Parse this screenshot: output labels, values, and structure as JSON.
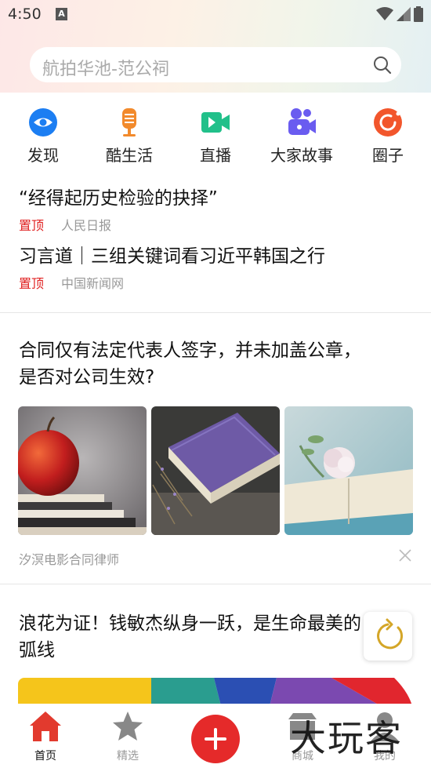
{
  "status_bar": {
    "time": "4:50",
    "a_badge": "A"
  },
  "search": {
    "placeholder": "航拍华池-范公祠"
  },
  "quick_nav": [
    {
      "label": "发现",
      "icon": "eye-icon",
      "color": "#1c7ef2"
    },
    {
      "label": "酷生活",
      "icon": "microphone-icon",
      "color": "#f28a2c"
    },
    {
      "label": "直播",
      "icon": "video-camera-icon",
      "color": "#21c08a"
    },
    {
      "label": "大家故事",
      "icon": "people-icon",
      "color": "#6a5cf0"
    },
    {
      "label": "圈子",
      "icon": "circle-icon",
      "color": "#f2562c"
    }
  ],
  "feed": {
    "pinned": [
      {
        "title": "“经得起历史检验的抉择”",
        "tag": "置顶",
        "source": "人民日报"
      },
      {
        "title": "习言道｜三组关键词看习近平韩国之行",
        "tag": "置顶",
        "source": "中国新闻网"
      }
    ],
    "article_1": {
      "title_line1": "合同仅有法定代表人签字，并未加盖公章，",
      "title_line2": "是否对公司生效?",
      "source": "汐溟电影合同律师"
    },
    "article_2": {
      "title_line1": "浪花为证！钱敏杰纵身一跃，是生命最美的",
      "title_line2": "弧线"
    }
  },
  "tabbar": {
    "items": [
      {
        "label": "首页",
        "icon": "home-icon",
        "active": true
      },
      {
        "label": "精选",
        "icon": "star-icon",
        "active": false
      },
      {
        "label": "",
        "icon": "plus-icon",
        "active": false
      },
      {
        "label": "商城",
        "icon": "shop-icon",
        "active": false
      },
      {
        "label": "我的",
        "icon": "user-icon",
        "active": false
      }
    ]
  },
  "watermark": "大玩客",
  "colors": {
    "accent": "#e52a2a",
    "pin": "#e02020",
    "muted": "#999999"
  }
}
